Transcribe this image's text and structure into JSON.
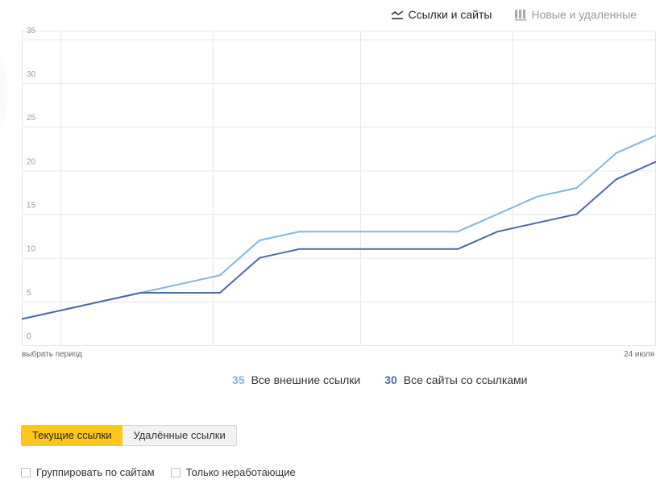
{
  "tabs": [
    {
      "label": "Ссылки и сайты",
      "icon": "line-chart-icon",
      "active": true
    },
    {
      "label": "Новые и удаленные",
      "icon": "bar-chart-icon",
      "active": false
    }
  ],
  "chart_data": {
    "type": "line",
    "ylim": [
      0,
      36
    ],
    "yticks": [
      "0",
      "5",
      "10",
      "15",
      "20",
      "25",
      "30",
      "35"
    ],
    "x_labels": {
      "left": "выбрать период",
      "right": "24 июля"
    },
    "grid": true,
    "series": [
      {
        "name": "Все внешние ссылки",
        "total": "35",
        "color": "#7fb6e0",
        "values": [
          3,
          4,
          5,
          6,
          7,
          8,
          12,
          13,
          13,
          13,
          13,
          13,
          15,
          17,
          18,
          22,
          24
        ]
      },
      {
        "name": "Все сайты со ссылками",
        "total": "30",
        "color": "#4a6aa5",
        "values": [
          3,
          4,
          5,
          6,
          6,
          6,
          10,
          11,
          11,
          11,
          11,
          11,
          13,
          14,
          15,
          19,
          21
        ]
      }
    ]
  },
  "segment": {
    "current_label": "Текущие ссылки",
    "removed_label": "Удалённые ссылки"
  },
  "options": {
    "group_label": "Группировать по сайтам",
    "broken_label": "Только неработающие"
  }
}
